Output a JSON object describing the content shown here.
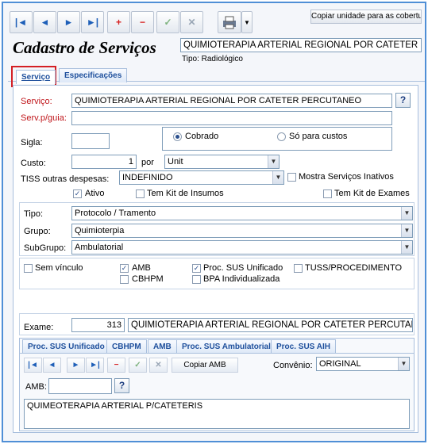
{
  "toolbar": {
    "buttons": [
      {
        "name": "first-record-button",
        "glyph": "|◄",
        "tone": "blue"
      },
      {
        "name": "prev-record-button",
        "glyph": "◄",
        "tone": "blue"
      },
      {
        "name": "next-record-button",
        "glyph": "►",
        "tone": "blue"
      },
      {
        "name": "last-record-button",
        "glyph": "►|",
        "tone": "blue"
      },
      {
        "name": "add-record-button",
        "glyph": "+",
        "tone": "red"
      },
      {
        "name": "delete-record-button",
        "glyph": "−",
        "tone": "red"
      },
      {
        "name": "confirm-button",
        "glyph": "✓",
        "tone": "green"
      },
      {
        "name": "cancel-button",
        "glyph": "✕",
        "tone": "gray"
      }
    ],
    "copy_button_label": "Copiar unidade para as coberturas"
  },
  "header": {
    "title": "Cadastro de Serviços",
    "service_name": "QUIMIOTERAPIA ARTERIAL REGIONAL POR CATETER PERC",
    "type_line": "Tipo: Radiológico"
  },
  "tabs": [
    "Serviço",
    "Especificações"
  ],
  "form": {
    "servico_label": "Serviço:",
    "servico_value": "QUIMIOTERAPIA ARTERIAL REGIONAL POR CATETER PERCUTANEO",
    "serv_guia_label": "Serv.p/guia:",
    "serv_guia_value": "",
    "sigla_label": "Sigla:",
    "sigla_value": "",
    "radio_cobrado": "Cobrado",
    "radio_custos": "Só para custos",
    "custo_label": "Custo:",
    "custo_value": "1",
    "por_label": "por",
    "unit_value": "Unit",
    "tiss_label": "TISS outras despesas:",
    "tiss_value": "INDEFINIDO",
    "mostra_inativos": "Mostra Serviços Inativos",
    "ativo": "Ativo",
    "kit_insumos": "Tem Kit de Insumos",
    "kit_exames": "Tem Kit de Exames",
    "tipo_label": "Tipo:",
    "tipo_value": "Protocolo / Tramento",
    "grupo_label": "Grupo:",
    "grupo_value": "Quimioterpia",
    "subgrupo_label": "SubGrupo:",
    "subgrupo_value": "Ambulatorial",
    "sem_vinculo": "Sem vínculo",
    "amb": "AMB",
    "cbhpm": "CBHPM",
    "proc_sus": "Proc. SUS Unificado",
    "bpa": "BPA Individualizada",
    "tuss": "TUSS/PROCEDIMENTO"
  },
  "exame": {
    "label": "Exame:",
    "code": "313",
    "name": "QUIMIOTERAPIA ARTERIAL REGIONAL POR CATETER PERCUTANEO",
    "tabs": [
      "Proc. SUS Unificado",
      "CBHPM",
      "AMB",
      "Proc. SUS Ambulatorial",
      "Proc. SUS AIH"
    ],
    "copiar_amb": "Copiar AMB",
    "convenio_label": "Convênio:",
    "convenio_value": "ORIGINAL",
    "amb_label": "AMB:",
    "amb_value": "",
    "description": "QUIMEOTERAPIA ARTERIAL P/CATETERIS"
  },
  "colors": {
    "accent": "#1e5fb8",
    "highlight_red": "#d41f24",
    "label_red": "#c0161b"
  }
}
